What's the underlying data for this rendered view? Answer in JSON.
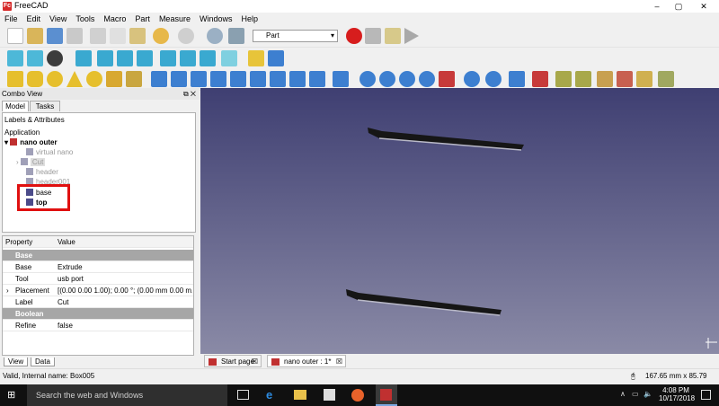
{
  "window": {
    "title": "FreeCAD",
    "app_icon": "Fc",
    "min": "–",
    "max": "▢",
    "close": "✕"
  },
  "menu": [
    "File",
    "Edit",
    "View",
    "Tools",
    "Macro",
    "Part",
    "Measure",
    "Windows",
    "Help"
  ],
  "toolbar": {
    "workbench": "Part"
  },
  "combo": {
    "title": "Combo View",
    "tabs": [
      "Model",
      "Tasks"
    ]
  },
  "tree": {
    "header": "Labels & Attributes",
    "root": "Application",
    "items": [
      {
        "label": "nano outer"
      },
      {
        "label": "virtual nano"
      },
      {
        "label": "Cut"
      },
      {
        "label": "header"
      },
      {
        "label": "header001"
      },
      {
        "label": "base"
      },
      {
        "label": "top"
      }
    ]
  },
  "properties": {
    "col_property": "Property",
    "col_value": "Value",
    "rows": [
      {
        "key": "Base",
        "value": ""
      },
      {
        "key": "Base",
        "value": "Extrude"
      },
      {
        "key": "Tool",
        "value": "usb port"
      },
      {
        "key": "Placement",
        "value": "[(0.00 0.00 1.00); 0.00 °; (0.00 mm  0.00 m..."
      },
      {
        "key": "Label",
        "value": "Cut"
      },
      {
        "key": "Boolean",
        "value": ""
      },
      {
        "key": "Refine",
        "value": "false"
      }
    ]
  },
  "bottom_tabs": [
    "View",
    "Data"
  ],
  "doc_tabs": [
    "Start page",
    "nano outer : 1*"
  ],
  "status": {
    "left": "Valid, Internal name: Box005",
    "right": "167.65 mm x 85.79 mm"
  },
  "taskbar": {
    "search": "Search the web and Windows",
    "time": "4:08 PM",
    "date": "10/17/2018"
  },
  "colors": {
    "viewport_top": "#3f3f72",
    "viewport_bottom": "#8a8aa6",
    "highlight": "#e01010"
  }
}
